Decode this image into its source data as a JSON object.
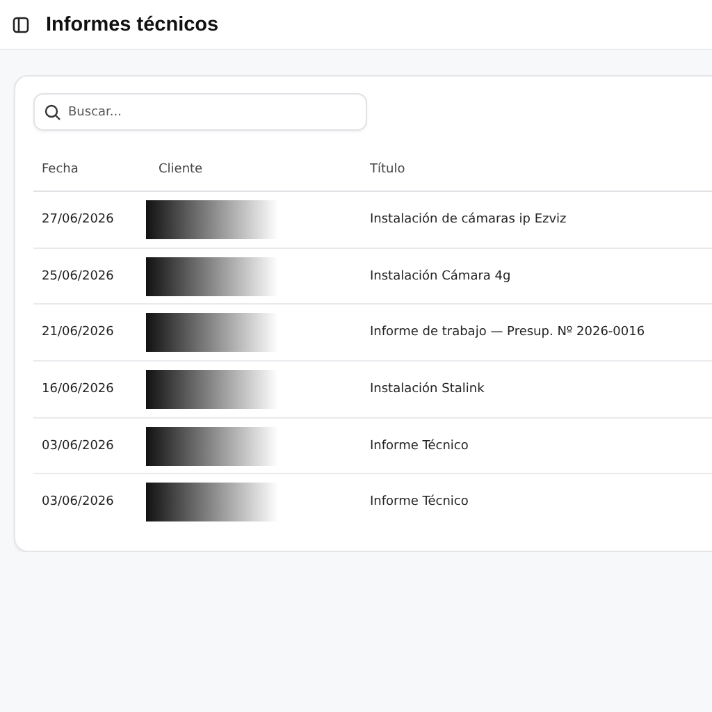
{
  "header": {
    "title": "Informes técnicos"
  },
  "search": {
    "placeholder": "Buscar..."
  },
  "table": {
    "columns": [
      "Fecha",
      "Cliente",
      "Título"
    ],
    "rows": [
      {
        "fecha": "27/06/2026",
        "cliente": {
          "redacted": true
        },
        "titulo": "Instalación de cámaras ip Ezviz"
      },
      {
        "fecha": "25/06/2026",
        "cliente": {
          "redacted": true
        },
        "titulo": "Instalación Cámara 4g"
      },
      {
        "fecha": "21/06/2026",
        "cliente": {
          "redacted": true
        },
        "titulo": "Informe de trabajo — Presup. Nº 2026-0016"
      },
      {
        "fecha": "16/06/2026",
        "cliente": {
          "redacted": true
        },
        "titulo": "Instalación Stalink"
      },
      {
        "fecha": "03/06/2026",
        "cliente": {
          "redacted": true
        },
        "titulo": "Informe Técnico"
      },
      {
        "fecha": "03/06/2026",
        "cliente": {
          "redacted": true
        },
        "titulo": "Informe Técnico"
      }
    ]
  }
}
